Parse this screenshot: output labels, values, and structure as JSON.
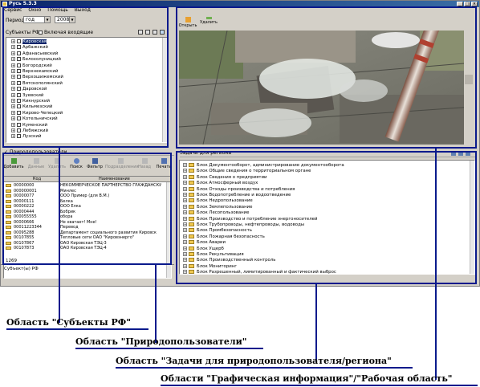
{
  "window": {
    "title": "Русь 5.3.3"
  },
  "menu": [
    "Сервис",
    "Окно",
    "Помощь",
    "Выход"
  ],
  "period": {
    "label": "Период",
    "type_value": "год",
    "year_value": "2008"
  },
  "subjects_panel": {
    "title": "Субъекты РФ",
    "include_label": "Включая входящие",
    "items": [
      "Кировская",
      "Арбажский",
      "Афанасьевский",
      "Белохолуницкий",
      "Богородский",
      "Верхнекамский",
      "Верхошижемский",
      "Вятскополянский",
      "Даровской",
      "Зуевский",
      "Кикнурский",
      "Кильмезский",
      "Кирово-Чепецкий",
      "Котельничский",
      "Куменский",
      "Лебяжский",
      "Лузский"
    ],
    "selected_index": 0
  },
  "users_panel": {
    "title": "Природопользователи",
    "toolbar": [
      "Добавить",
      "Данные",
      "Удалить",
      "Поиск",
      "Фильтр",
      "Подразделения",
      "Назад",
      "Печать"
    ],
    "columns": [
      "Код",
      "Наименование"
    ],
    "rows": [
      [
        "00000000",
        "НЕКОММЕРЧЕСКОЕ ПАРТНЕРСТВО ГРАЖДАНСКИЙ ЦЕНТ..."
      ],
      [
        "000000001",
        "Минлес"
      ],
      [
        "00000077",
        "ООО Пример (для В.М.)"
      ],
      [
        "00000111",
        "Белка"
      ],
      [
        "00000222",
        "ООО Елка"
      ],
      [
        "00000444",
        "Бобрик"
      ],
      [
        "000055555",
        "обора"
      ],
      [
        "00000666",
        "Не хватает! Мне!"
      ],
      [
        "00011223344",
        "Перевод"
      ],
      [
        "00095288",
        "Департамент социального развития Кировск"
      ],
      [
        "00107855",
        "Тепловые сети ОАО \"Кировэнерго\""
      ],
      [
        "00107867",
        "ОАО Кировская ТЭЦ-3"
      ],
      [
        "00107873",
        "ОАО Кировская ТЭЦ-4"
      ]
    ],
    "count": "1269",
    "footer": "Субъект(ы) РФ"
  },
  "graphics_panel": {
    "toolbar": [
      "Открыть",
      "Удалить"
    ]
  },
  "tasks_panel": {
    "title": "Задачи для региона",
    "items": [
      "Блок Документооборот, администрирование документооборота",
      "Блок Общие сведения о территориальном органе",
      "Блок Сведения о предприятии",
      "Блок Атмосферный воздух",
      "Блок Отходы производства и потребления",
      "Блок Водопотребление и водоотведение",
      "Блок Недропользование",
      "Блок Землепользование",
      "Блок Лесопользование",
      "Блок Производство и потребление энергоносителей",
      "Блок Трубопроводы, нефтепроводы, водоводы",
      "Блок Промбезопасность",
      "Блок Пожарная безопасность",
      "Блок Аварии",
      "Блок Ущерб",
      "Блок Рекультивация",
      "Блок Производственный контроль",
      "Блок Мониторинг",
      "Блок Разрешенный, лимитированный и фактический выброс"
    ]
  },
  "captions": [
    "Область \"Субъекты РФ\"",
    "Область \"Природопользователи\"",
    "Область \"Задачи для природопользователя/региона\"",
    "Области \"Графическая информация\"/\"Рабочая область\""
  ]
}
